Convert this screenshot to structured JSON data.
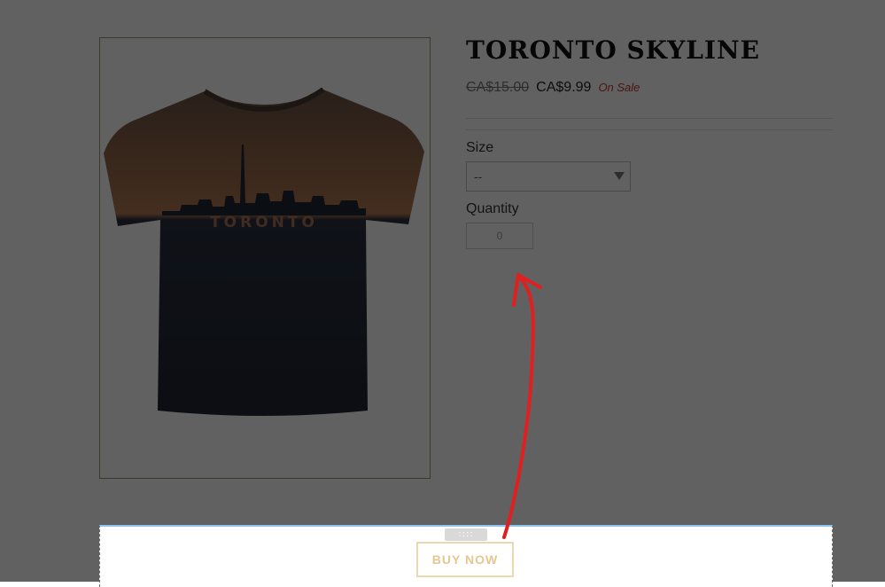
{
  "product": {
    "title": "TORONTO SKYLINE",
    "image_text": "TORONTO",
    "price_compare": "CA$15.00",
    "price_current": "CA$9.99",
    "sale_label": "On Sale"
  },
  "options": {
    "size_label": "Size",
    "size_value": "--",
    "quantity_label": "Quantity",
    "quantity_value": "0"
  },
  "editor": {
    "drag_handle": "::::",
    "buy_button_label": "BUY NOW"
  },
  "colors": {
    "overlay": "#000000",
    "sale": "#c0392b",
    "buy_button_text": "#e5c791",
    "buy_button_border": "#ecd8b0",
    "section_top_border": "#8ec4f0",
    "annotation_arrow": "#e02020"
  },
  "icons": {
    "select_chevron": "chevron-down-icon",
    "drag_handle": "drag-handle-icon",
    "annotation": "arrow-annotation-icon"
  }
}
